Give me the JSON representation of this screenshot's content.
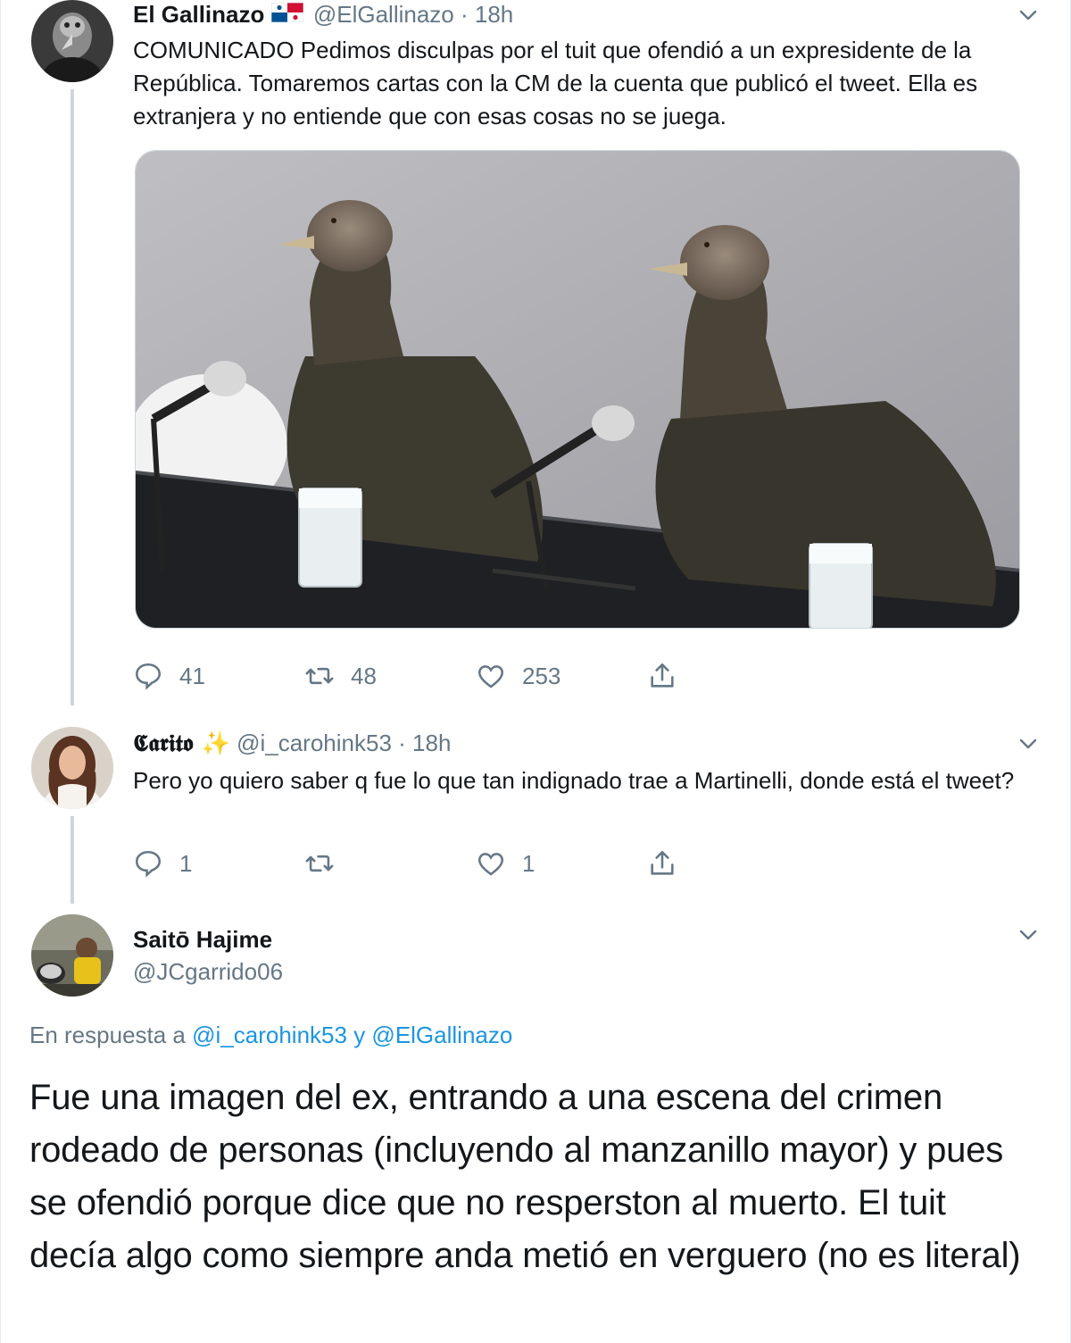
{
  "tweet1": {
    "name": "El Gallinazo",
    "handle": "@ElGallinazo",
    "time": "18h",
    "text": "COMUNICADO Pedimos disculpas por el tuit que ofendió a un expresidente de la República. Tomaremos cartas con la CM de la cuenta que publicó el tweet. Ella es extranjera y no entiende que con esas cosas no se juega.",
    "replies": "41",
    "retweets": "48",
    "likes": "253"
  },
  "tweet2": {
    "name": "𝕮𝖆𝖗𝖎𝖙𝖔 ✨",
    "handle": "@i_carohink53",
    "time": "18h",
    "text": "Pero yo quiero saber q fue lo que tan indignado trae a Martinelli, donde está el tweet?",
    "replies": "1",
    "retweets": "",
    "likes": "1"
  },
  "tweet3": {
    "name": "Saitō Hajime",
    "handle": "@JCgarrido06",
    "reply_prefix": "En respuesta a",
    "reply_user1": "@i_carohink53",
    "reply_conj": "y",
    "reply_user2": "@ElGallinazo",
    "text": "Fue una imagen del ex, entrando a una escena del crimen rodeado de personas (incluyendo al manzanillo mayor) y pues se ofendió porque dice que no resperston al muerto. El tuit decía algo como siempre anda metió en verguero (no es literal)"
  },
  "colors": {
    "text": "#14171a",
    "secondary": "#657786",
    "link": "#1b95e0",
    "line": "#ccd6dd"
  },
  "icons": [
    "reply-icon",
    "retweet-icon",
    "like-icon",
    "share-icon",
    "chevron-down-icon",
    "panama-flag-icon"
  ]
}
